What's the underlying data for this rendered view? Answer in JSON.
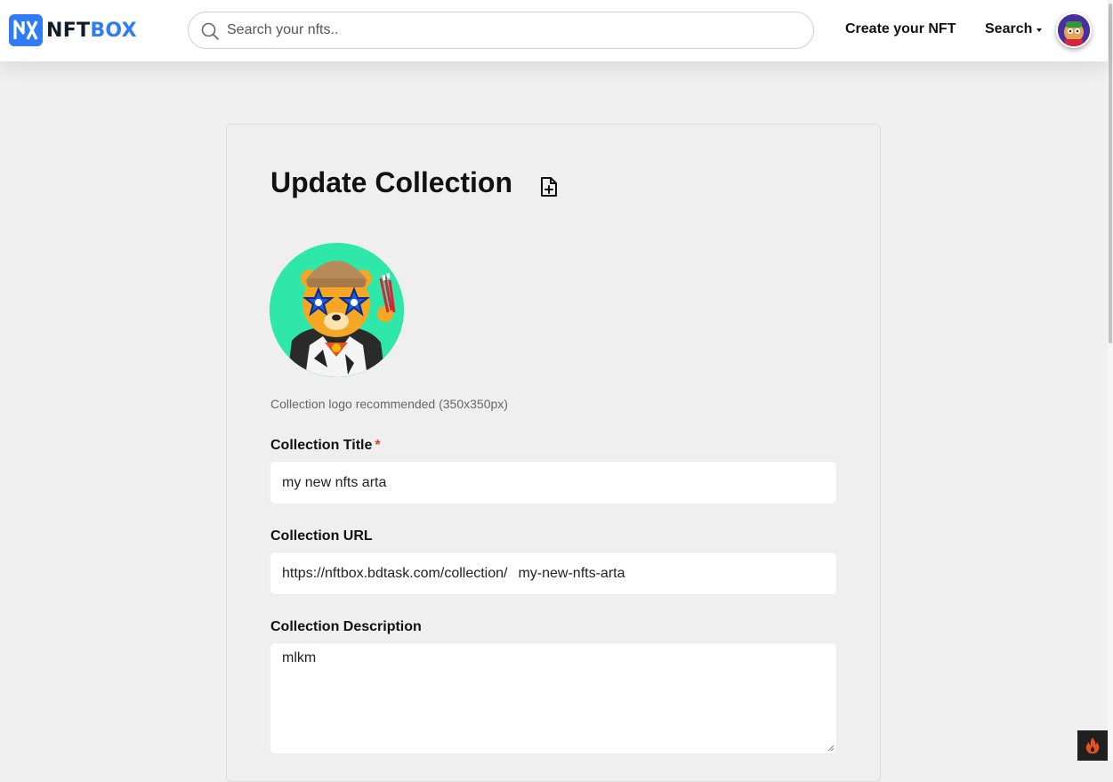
{
  "brand": {
    "name_a": "NFT",
    "name_b": "BOX"
  },
  "header": {
    "search_placeholder": "Search your nfts..",
    "create_label": "Create your NFT",
    "search_menu_label": "Search"
  },
  "form": {
    "title": "Update Collection",
    "logo_hint": "Collection logo recommended (350x350px)",
    "title_label": "Collection Title",
    "required_mark": "*",
    "title_value": "my new nfts arta",
    "url_label": "Collection URL",
    "url_prefix": "https://nftbox.bdtask.com/collection/",
    "url_value": "my-new-nfts-arta",
    "description_label": "Collection Description",
    "description_value": "mlkm"
  },
  "colors": {
    "brand_blue": "#2f7cf6",
    "page_bg": "#f0f0f0",
    "required_red": "#e53935",
    "logo_bg": "#2ee7a8"
  },
  "icons": [
    "nftbox-logo-icon",
    "search-icon",
    "file-plus-icon",
    "fire-icon"
  ]
}
